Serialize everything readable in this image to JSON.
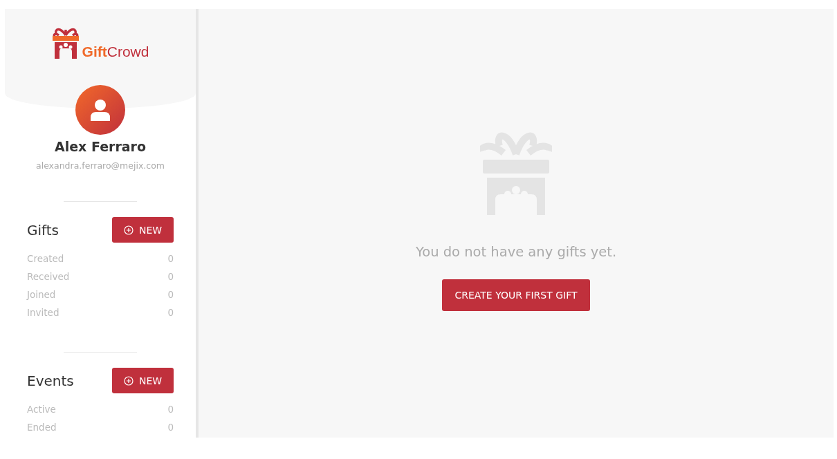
{
  "sidebar": {
    "logo": {
      "first": "Gift",
      "second": "Crowd"
    },
    "user": {
      "name": "Alex Ferraro",
      "email": "alexandra.ferraro@mejix.com"
    },
    "sections": [
      {
        "title": "Gifts",
        "button": "NEW",
        "stats": [
          {
            "label": "Created",
            "value": "0"
          },
          {
            "label": "Received",
            "value": "0"
          },
          {
            "label": "Joined",
            "value": "0"
          },
          {
            "label": "Invited",
            "value": "0"
          }
        ]
      },
      {
        "title": "Events",
        "button": "NEW",
        "stats": [
          {
            "label": "Active",
            "value": "0"
          },
          {
            "label": "Ended",
            "value": "0"
          }
        ]
      }
    ]
  },
  "main": {
    "empty_message": "You do not have any gifts yet.",
    "button": "CREATE YOUR FIRST GIFT"
  }
}
